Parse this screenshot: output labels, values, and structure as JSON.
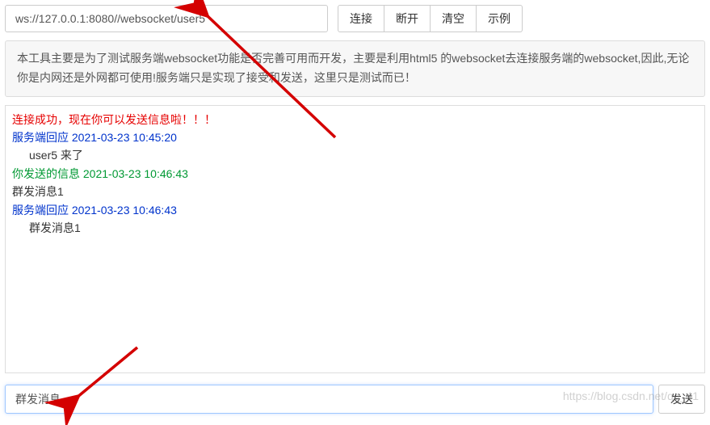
{
  "toolbar": {
    "url_value": "ws://127.0.0.1:8080//websocket/user5",
    "connect_label": "连接",
    "disconnect_label": "断开",
    "clear_label": "清空",
    "example_label": "示例"
  },
  "info_text": "本工具主要是为了测试服务端websocket功能是否完善可用而开发，主要是利用html5 的websocket去连接服务端的websocket,因此,无论你是内网还是外网都可使用!服务端只是实现了接受和发送，这里只是测试而已！",
  "log": {
    "connected": "连接成功，现在你可以发送信息啦！！！",
    "server_resp_1": "服务端回应 2021-03-23 10:45:20",
    "server_resp_1_body": "user5 来了",
    "you_sent": "你发送的信息 2021-03-23 10:46:43",
    "you_sent_body": "群发消息1",
    "server_resp_2": "服务端回应 2021-03-23 10:46:43",
    "server_resp_2_body": "群发消息1"
  },
  "compose": {
    "value": "群发消息",
    "send_label": "发送"
  },
  "watermark": "https://blog.csdn.net/qq_41"
}
